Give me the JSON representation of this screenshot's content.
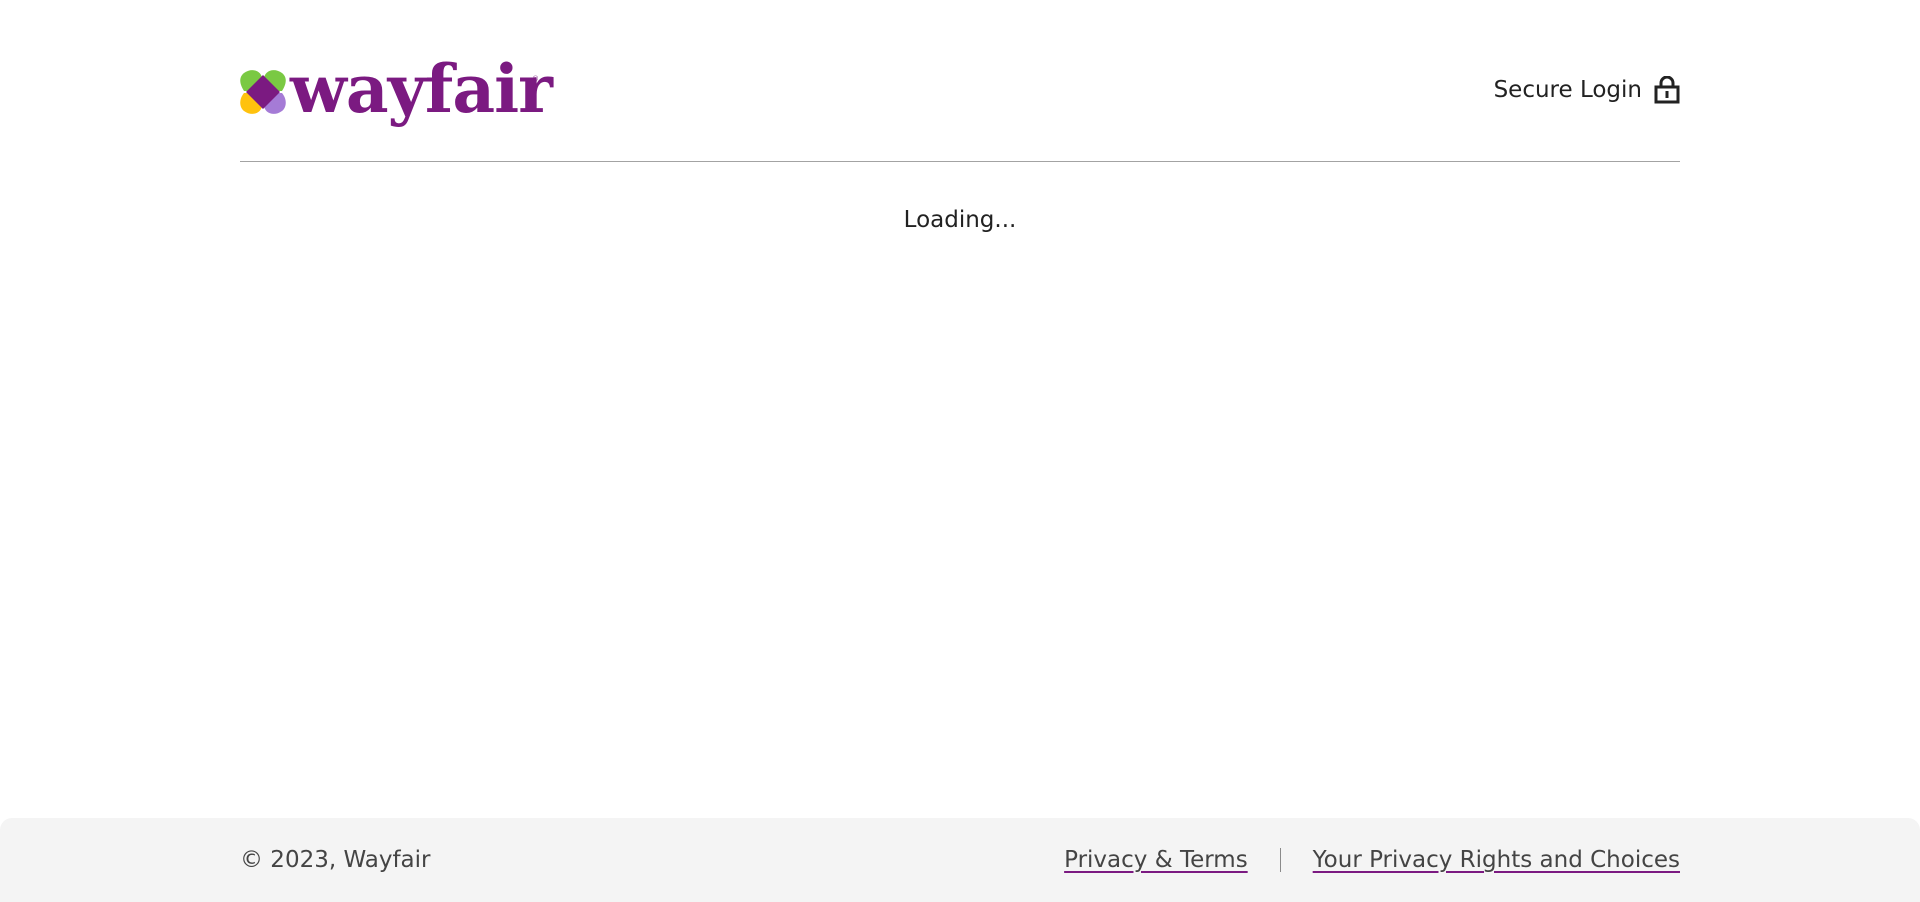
{
  "brand": {
    "name": "wayfair",
    "color": "#7b1a81",
    "logo_colors": {
      "green": "#7ac943",
      "purple": "#7b1a81",
      "yellow": "#ffc20e",
      "lavender": "#a57bd6"
    }
  },
  "header": {
    "secure_login_label": "Secure Login",
    "secure_login_icon": "lock-icon"
  },
  "main": {
    "status_text": "Loading..."
  },
  "footer": {
    "copyright": "© 2023, Wayfair",
    "links": [
      {
        "label": "Privacy & Terms"
      },
      {
        "label": "Your Privacy Rights and Choices"
      }
    ]
  }
}
